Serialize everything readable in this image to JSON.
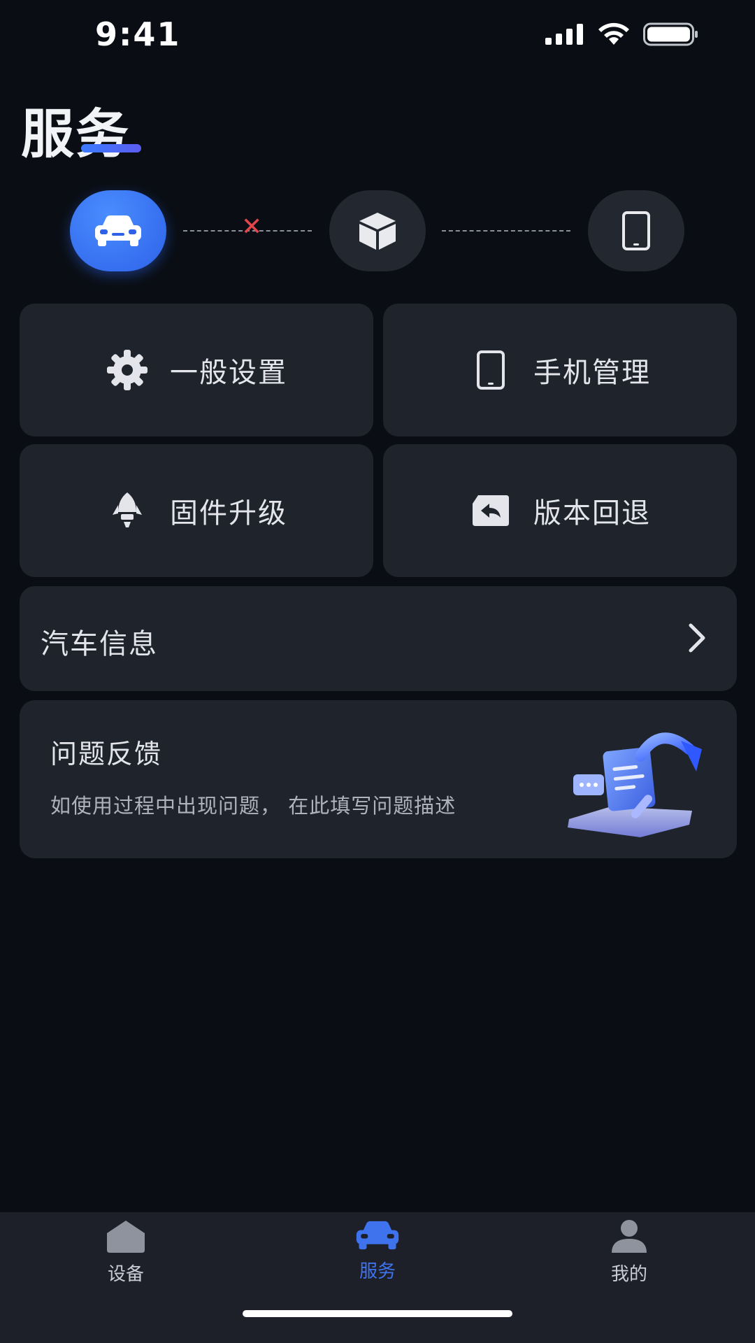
{
  "status_bar": {
    "time": "9:41"
  },
  "page": {
    "title": "服务"
  },
  "steps": [
    {
      "icon": "car-icon",
      "state": "active"
    },
    {
      "icon": "box-icon",
      "state": "inactive"
    },
    {
      "icon": "phone-icon",
      "state": "inactive"
    }
  ],
  "tiles": [
    {
      "label": "一般设置",
      "icon": "gear-icon"
    },
    {
      "label": "手机管理",
      "icon": "phone-icon"
    },
    {
      "label": "固件升级",
      "icon": "rocket-icon"
    },
    {
      "label": "版本回退",
      "icon": "rollback-icon"
    }
  ],
  "car_info": {
    "label": "汽车信息"
  },
  "feedback": {
    "title": "问题反馈",
    "description": "如使用过程中出现问题， 在此填写问题描述"
  },
  "tab_bar": {
    "tabs": [
      {
        "label": "设备",
        "icon": "home-icon",
        "active": false
      },
      {
        "label": "服务",
        "icon": "car-icon",
        "active": true
      },
      {
        "label": "我的",
        "icon": "user-icon",
        "active": false
      }
    ]
  },
  "colors": {
    "accent": "#3f73ee",
    "background": "#0a0e14",
    "card": "#1f232c",
    "error": "#e0464a"
  }
}
